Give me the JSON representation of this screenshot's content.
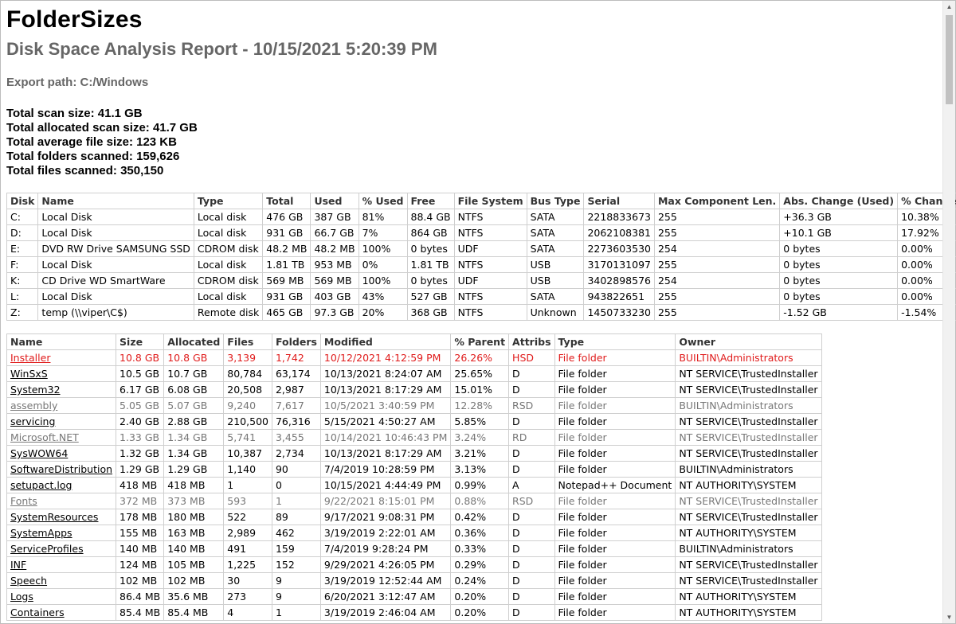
{
  "report": {
    "title": "FolderSizes",
    "subtitle": "Disk Space Analysis Report - 10/15/2021 5:20:39 PM",
    "export_path": "Export path: C:/Windows",
    "stats": [
      "Total scan size: 41.1 GB",
      "Total allocated scan size: 41.7 GB",
      "Total average file size: 123 KB",
      "Total folders scanned: 159,626",
      "Total files scanned: 350,150"
    ]
  },
  "disks": {
    "headers": [
      "Disk",
      "Name",
      "Type",
      "Total",
      "Used",
      "% Used",
      "Free",
      "File System",
      "Bus Type",
      "Serial",
      "Max Component Len.",
      "Abs. Change (Used)",
      "% Change (Used)"
    ],
    "rows": [
      [
        "C:",
        "Local Disk",
        "Local disk",
        "476 GB",
        "387 GB",
        "81%",
        "88.4 GB",
        "NTFS",
        "SATA",
        "2218833673",
        "255",
        "+36.3 GB",
        "10.38%"
      ],
      [
        "D:",
        "Local Disk",
        "Local disk",
        "931 GB",
        "66.7 GB",
        "7%",
        "864 GB",
        "NTFS",
        "SATA",
        "2062108381",
        "255",
        "+10.1 GB",
        "17.92%"
      ],
      [
        "E:",
        "DVD RW Drive SAMSUNG SSD",
        "CDROM disk",
        "48.2 MB",
        "48.2 MB",
        "100%",
        "0 bytes",
        "UDF",
        "SATA",
        "2273603530",
        "254",
        "0 bytes",
        "0.00%"
      ],
      [
        "F:",
        "Local Disk",
        "Local disk",
        "1.81 TB",
        "953 MB",
        "0%",
        "1.81 TB",
        "NTFS",
        "USB",
        "3170131097",
        "255",
        "0 bytes",
        "0.00%"
      ],
      [
        "K:",
        "CD Drive WD SmartWare",
        "CDROM disk",
        "569 MB",
        "569 MB",
        "100%",
        "0 bytes",
        "UDF",
        "USB",
        "3402898576",
        "254",
        "0 bytes",
        "0.00%"
      ],
      [
        "L:",
        "Local Disk",
        "Local disk",
        "931 GB",
        "403 GB",
        "43%",
        "527 GB",
        "NTFS",
        "SATA",
        "943822651",
        "255",
        "0 bytes",
        "0.00%"
      ],
      [
        "Z:",
        "temp (\\\\viper\\C$)",
        "Remote disk",
        "465 GB",
        "97.3 GB",
        "20%",
        "368 GB",
        "NTFS",
        "Unknown",
        "1450733230",
        "255",
        "-1.52 GB",
        "-1.54%"
      ]
    ]
  },
  "files": {
    "headers": [
      "Name",
      "Size",
      "Allocated",
      "Files",
      "Folders",
      "Modified",
      "% Parent",
      "Attribs",
      "Type",
      "Owner"
    ],
    "rows": [
      {
        "style": "red",
        "cells": [
          "Installer",
          "10.8 GB",
          "10.8 GB",
          "3,139",
          "1,742",
          "10/12/2021 4:12:59 PM",
          "26.26%",
          "HSD",
          "File folder",
          "BUILTIN\\Administrators"
        ]
      },
      {
        "style": "normal",
        "cells": [
          "WinSxS",
          "10.5 GB",
          "10.7 GB",
          "80,784",
          "63,174",
          "10/13/2021 8:24:07 AM",
          "25.65%",
          "D",
          "File folder",
          "NT SERVICE\\TrustedInstaller"
        ]
      },
      {
        "style": "normal",
        "cells": [
          "System32",
          "6.17 GB",
          "6.08 GB",
          "20,508",
          "2,987",
          "10/13/2021 8:17:29 AM",
          "15.01%",
          "D",
          "File folder",
          "NT SERVICE\\TrustedInstaller"
        ]
      },
      {
        "style": "gray",
        "cells": [
          "assembly",
          "5.05 GB",
          "5.07 GB",
          "9,240",
          "7,617",
          "10/5/2021 3:40:59 PM",
          "12.28%",
          "RSD",
          "File folder",
          "BUILTIN\\Administrators"
        ]
      },
      {
        "style": "normal",
        "cells": [
          "servicing",
          "2.40 GB",
          "2.88 GB",
          "210,500",
          "76,316",
          "5/15/2021 4:50:27 AM",
          "5.85%",
          "D",
          "File folder",
          "NT SERVICE\\TrustedInstaller"
        ]
      },
      {
        "style": "gray",
        "cells": [
          "Microsoft.NET",
          "1.33 GB",
          "1.34 GB",
          "5,741",
          "3,455",
          "10/14/2021 10:46:43 PM",
          "3.24%",
          "RD",
          "File folder",
          "NT SERVICE\\TrustedInstaller"
        ]
      },
      {
        "style": "normal",
        "cells": [
          "SysWOW64",
          "1.32 GB",
          "1.34 GB",
          "10,387",
          "2,734",
          "10/13/2021 8:17:29 AM",
          "3.21%",
          "D",
          "File folder",
          "NT SERVICE\\TrustedInstaller"
        ]
      },
      {
        "style": "normal",
        "cells": [
          "SoftwareDistribution",
          "1.29 GB",
          "1.29 GB",
          "1,140",
          "90",
          "7/4/2019 10:28:59 PM",
          "3.13%",
          "D",
          "File folder",
          "BUILTIN\\Administrators"
        ]
      },
      {
        "style": "normal",
        "cells": [
          "setupact.log",
          "418 MB",
          "418 MB",
          "1",
          "0",
          "10/15/2021 4:44:49 PM",
          "0.99%",
          "A",
          "Notepad++ Document",
          "NT AUTHORITY\\SYSTEM"
        ]
      },
      {
        "style": "gray",
        "cells": [
          "Fonts",
          "372 MB",
          "373 MB",
          "593",
          "1",
          "9/22/2021 8:15:01 PM",
          "0.88%",
          "RSD",
          "File folder",
          "NT SERVICE\\TrustedInstaller"
        ]
      },
      {
        "style": "normal",
        "cells": [
          "SystemResources",
          "178 MB",
          "180 MB",
          "522",
          "89",
          "9/17/2021 9:08:31 PM",
          "0.42%",
          "D",
          "File folder",
          "NT SERVICE\\TrustedInstaller"
        ]
      },
      {
        "style": "normal",
        "cells": [
          "SystemApps",
          "155 MB",
          "163 MB",
          "2,989",
          "462",
          "3/19/2019 2:22:01 AM",
          "0.36%",
          "D",
          "File folder",
          "NT AUTHORITY\\SYSTEM"
        ]
      },
      {
        "style": "normal",
        "cells": [
          "ServiceProfiles",
          "140 MB",
          "140 MB",
          "491",
          "159",
          "7/4/2019 9:28:24 PM",
          "0.33%",
          "D",
          "File folder",
          "BUILTIN\\Administrators"
        ]
      },
      {
        "style": "normal",
        "cells": [
          "INF",
          "124 MB",
          "105 MB",
          "1,225",
          "152",
          "9/29/2021 4:26:05 PM",
          "0.29%",
          "D",
          "File folder",
          "NT SERVICE\\TrustedInstaller"
        ]
      },
      {
        "style": "normal",
        "cells": [
          "Speech",
          "102 MB",
          "102 MB",
          "30",
          "9",
          "3/19/2019 12:52:44 AM",
          "0.24%",
          "D",
          "File folder",
          "NT SERVICE\\TrustedInstaller"
        ]
      },
      {
        "style": "normal",
        "cells": [
          "Logs",
          "86.4 MB",
          "35.6 MB",
          "273",
          "9",
          "6/20/2021 3:12:47 AM",
          "0.20%",
          "D",
          "File folder",
          "NT AUTHORITY\\SYSTEM"
        ]
      },
      {
        "style": "normal",
        "cells": [
          "Containers",
          "85.4 MB",
          "85.4 MB",
          "4",
          "1",
          "3/19/2019 2:46:04 AM",
          "0.20%",
          "D",
          "File folder",
          "NT AUTHORITY\\SYSTEM"
        ]
      }
    ]
  }
}
